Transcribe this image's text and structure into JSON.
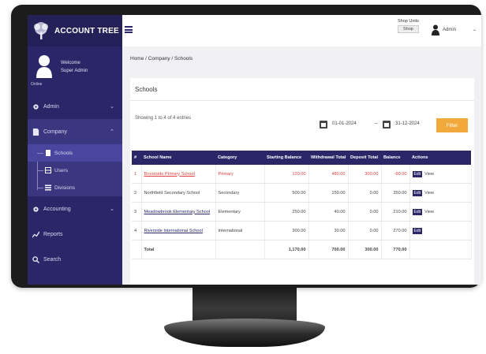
{
  "app": {
    "brand": "ACCOUNT TREE"
  },
  "sidebar": {
    "user_name": "Welcome",
    "user_role": "Super Admin",
    "status": "Online",
    "items": [
      {
        "label": "Admin",
        "icon": "gear-icon"
      },
      {
        "label": "Company",
        "icon": "file-icon"
      },
      {
        "label": "Accounting",
        "icon": "gear-icon"
      },
      {
        "label": "Reports",
        "icon": "chart-icon"
      },
      {
        "label": "Search",
        "icon": "search-icon"
      }
    ],
    "sub_items": [
      {
        "label": "Schools",
        "icon": "document-icon"
      },
      {
        "label": "Users",
        "icon": "users-icon"
      },
      {
        "label": "Divisions",
        "icon": "list-icon"
      }
    ]
  },
  "topbar": {
    "shop_label": "Shop Units",
    "shop_button": "Shop",
    "user_name": "Admin"
  },
  "breadcrumb": "Home  /  Company  /  Schools",
  "card": {
    "title": "Schools",
    "showing": "Showing 1 to 4 of 4 entries",
    "date_from": "01-01-2024",
    "date_to": "31-12-2024",
    "filter_label": "Filter"
  },
  "table": {
    "headers": [
      "#",
      "School Name",
      "Category",
      "Starting Balance",
      "Withdrawal Total",
      "Deposit Total",
      "Balance",
      "Actions"
    ],
    "rows": [
      {
        "index": "1",
        "name": "Brookside Primary School",
        "category": "Primary",
        "starting": "120.00",
        "withdrawal": "480.00",
        "deposit": "300.00",
        "balance": "-60.00",
        "action": "Edit",
        "action_label": "View"
      },
      {
        "index": "2",
        "name": "Northfield Secondary School",
        "category": "Secondary",
        "starting": "500.00",
        "withdrawal": "150.00",
        "deposit": "0.00",
        "balance": "350.00",
        "action": "Edit",
        "action_label": "View"
      },
      {
        "index": "3",
        "name": "Meadowbrook Elementary School",
        "category": "Elementary",
        "starting": "250.00",
        "withdrawal": "40.00",
        "deposit": "0.00",
        "balance": "210.00",
        "action": "Edit",
        "action_label": "View"
      },
      {
        "index": "4",
        "name": "Riverside International School",
        "category": "International",
        "starting": "300.00",
        "withdrawal": "30.00",
        "deposit": "0.00",
        "balance": "270.00",
        "action": "Edit",
        "action_label": ""
      }
    ],
    "total": {
      "label": "Total",
      "starting": "1,170.00",
      "withdrawal": "700.00",
      "deposit": "300.00",
      "balance": "770.00"
    }
  }
}
